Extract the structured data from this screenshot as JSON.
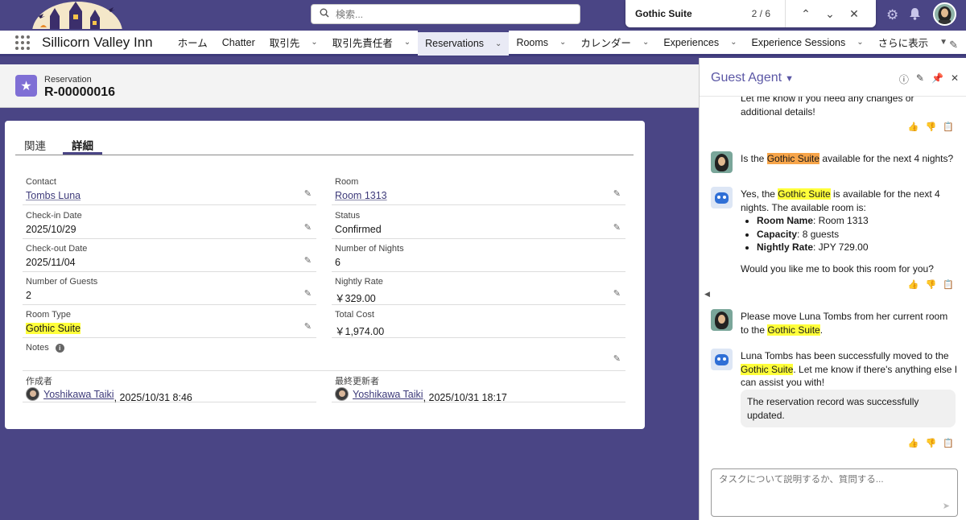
{
  "search": {
    "placeholder": "検索..."
  },
  "find": {
    "query": "Gothic Suite",
    "count": "2 / 6"
  },
  "app": {
    "name": "Sillicorn Valley Inn"
  },
  "nav": [
    {
      "label": "ホーム",
      "chevron": false,
      "active": false
    },
    {
      "label": "Chatter",
      "chevron": false,
      "active": false
    },
    {
      "label": "取引先",
      "chevron": true,
      "active": false
    },
    {
      "label": "取引先責任者",
      "chevron": true,
      "active": false
    },
    {
      "label": "Reservations",
      "chevron": true,
      "active": true
    },
    {
      "label": "Rooms",
      "chevron": true,
      "active": false
    },
    {
      "label": "カレンダー",
      "chevron": true,
      "active": false
    },
    {
      "label": "Experiences",
      "chevron": true,
      "active": false
    },
    {
      "label": "Experience Sessions",
      "chevron": true,
      "active": false
    },
    {
      "label": "さらに表示",
      "chevron": true,
      "active": false
    }
  ],
  "record": {
    "object": "Reservation",
    "name": "R-00000016"
  },
  "tabs": {
    "related": "関連",
    "details": "詳細"
  },
  "fields": {
    "contact": {
      "label": "Contact",
      "value": "Tombs Luna"
    },
    "room": {
      "label": "Room",
      "value": "Room 1313"
    },
    "checkin": {
      "label": "Check-in Date",
      "value": "2025/10/29"
    },
    "status": {
      "label": "Status",
      "value": "Confirmed"
    },
    "checkout": {
      "label": "Check-out Date",
      "value": "2025/11/04"
    },
    "nights": {
      "label": "Number of Nights",
      "value": "6"
    },
    "guests": {
      "label": "Number of Guests",
      "value": "2"
    },
    "rate": {
      "label": "Nightly Rate",
      "value": "￥329.00"
    },
    "roomtype": {
      "label": "Room Type",
      "value": "Gothic Suite"
    },
    "total": {
      "label": "Total Cost",
      "value": "￥1,974.00"
    },
    "notes": {
      "label": "Notes"
    },
    "created": {
      "label": "作成者",
      "user": "Yoshikawa Taiki",
      "date": ", 2025/10/31 8:46"
    },
    "modified": {
      "label": "最終更新者",
      "user": "Yoshikawa Taiki",
      "date": ", 2025/10/31 18:17"
    }
  },
  "agent": {
    "title": "Guest Agent",
    "m0": "Let me know if you need any changes or additional details!",
    "m1_pre": "Is the ",
    "m1_hl": "Gothic Suite",
    "m1_post": " available for the next 4 nights?",
    "m2_pre": "Yes, the ",
    "m2_hl": "Gothic Suite",
    "m2_post": " is available for the next 4 nights. The available room is:",
    "m2_b1_k": "Room Name",
    "m2_b1_v": ": Room 1313",
    "m2_b2_k": "Capacity",
    "m2_b2_v": ": 8 guests",
    "m2_b3_k": "Nightly Rate",
    "m2_b3_v": ": JPY 729.00",
    "m2_q": "Would you like me to book this room for you?",
    "m3_pre": "Please move Luna Tombs from her current room to the ",
    "m3_hl": "Gothic Suite",
    "m3_post": ".",
    "m4_pre": "Luna Tombs has been successfully moved to the ",
    "m4_hl": "Gothic Suite",
    "m4_post": ". Let me know if there's anything else I can assist you with!",
    "m4_status": "The reservation record was successfully updated.",
    "composer_placeholder": "タスクについて説明するか、質問する..."
  }
}
